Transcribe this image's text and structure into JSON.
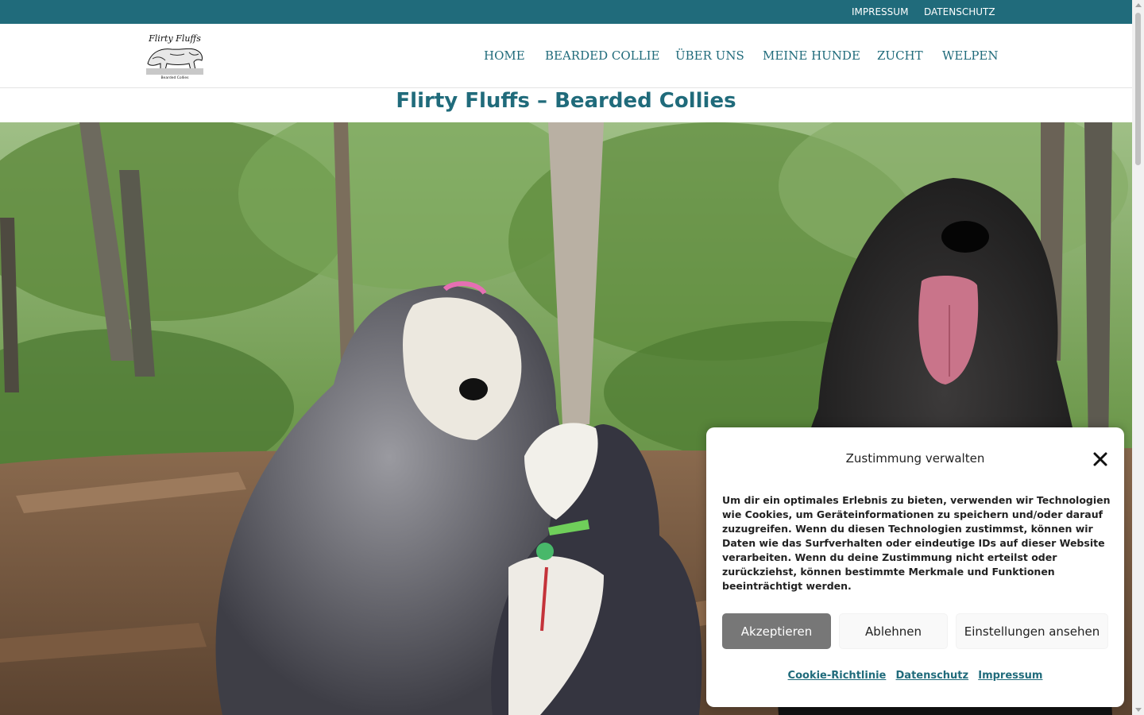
{
  "topbar": {
    "links": [
      "IMPRESSUM",
      "DATENSCHUTZ"
    ],
    "bg_color": "#206b7b"
  },
  "header": {
    "logo": {
      "text": "Flirty Fluffs",
      "subtext": "Bearded Collies",
      "icon": "dog-logo"
    },
    "nav": [
      "HOME",
      "BEARDED COLLIE",
      "ÜBER UNS",
      "MEINE HUNDE",
      "ZUCHT",
      "WELPEN"
    ]
  },
  "page": {
    "title": "Flirty Fluffs – Bearded Collies",
    "accent_color": "#206b7b"
  },
  "hero": {
    "icon": "forest-photo-with-three-bearded-collies"
  },
  "cookie_banner": {
    "title": "Zustimmung verwalten",
    "close_icon": "close-icon",
    "body": "Um dir ein optimales Erlebnis zu bieten, verwenden wir Technologien wie Cookies, um Geräteinformationen zu speichern und/oder darauf zuzugreifen. Wenn du diesen Technologien zustimmst, können wir Daten wie das Surfverhalten oder eindeutige IDs auf dieser Website verarbeiten. Wenn du deine Zustimmung nicht erteilst oder zurückziehst, können bestimmte Merkmale und Funktionen beeinträchtigt werden.",
    "buttons": {
      "accept": "Akzeptieren",
      "deny": "Ablehnen",
      "preferences": "Einstellungen ansehen"
    },
    "links": [
      "Cookie-Richtlinie",
      "Datenschutz",
      "Impressum"
    ]
  }
}
